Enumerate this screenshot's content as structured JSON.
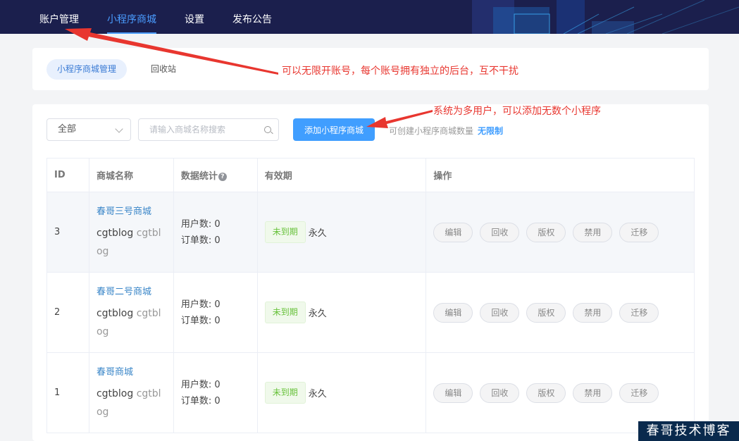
{
  "nav": {
    "items": [
      "账户管理",
      "小程序商城",
      "设置",
      "发布公告"
    ],
    "active_index": 1
  },
  "tabs": {
    "active": "小程序商城管理",
    "other": "回收站"
  },
  "filter": {
    "select_value": "全部",
    "search_placeholder": "请输入商城名称搜索",
    "add_button": "添加小程序商城",
    "quota_label": "可创建小程序商城数量",
    "quota_value": "无限制"
  },
  "table": {
    "headers": {
      "id": "ID",
      "name": "商城名称",
      "stats": "数据统计",
      "validity": "有效期",
      "actions": "操作"
    },
    "help_icon": "?",
    "rows": [
      {
        "id": "3",
        "name": "春哥三号商城",
        "owner": "cgtblog",
        "owner_secondary": "cgtblog",
        "users": "用户数: 0",
        "orders": "订单数: 0",
        "status": "未到期",
        "validity": "永久"
      },
      {
        "id": "2",
        "name": "春哥二号商城",
        "owner": "cgtblog",
        "owner_secondary": "cgtblog",
        "users": "用户数: 0",
        "orders": "订单数: 0",
        "status": "未到期",
        "validity": "永久"
      },
      {
        "id": "1",
        "name": "春哥商城",
        "owner": "cgtblog",
        "owner_secondary": "cgtblog",
        "users": "用户数: 0",
        "orders": "订单数: 0",
        "status": "未到期",
        "validity": "永久"
      }
    ],
    "actions": [
      "编辑",
      "回收",
      "版权",
      "禁用",
      "迁移"
    ]
  },
  "annotations": {
    "note1": "可以无限开账号，每个账号拥有独立的后台，互不干扰",
    "note2": "系统为多用户，可以添加无数个小程序"
  },
  "watermark": "春哥技术博客",
  "colors": {
    "nav_bg": "#1b1f4d",
    "accent": "#409eff",
    "annotation": "#e8362f",
    "badge_green": "#67c23a"
  }
}
